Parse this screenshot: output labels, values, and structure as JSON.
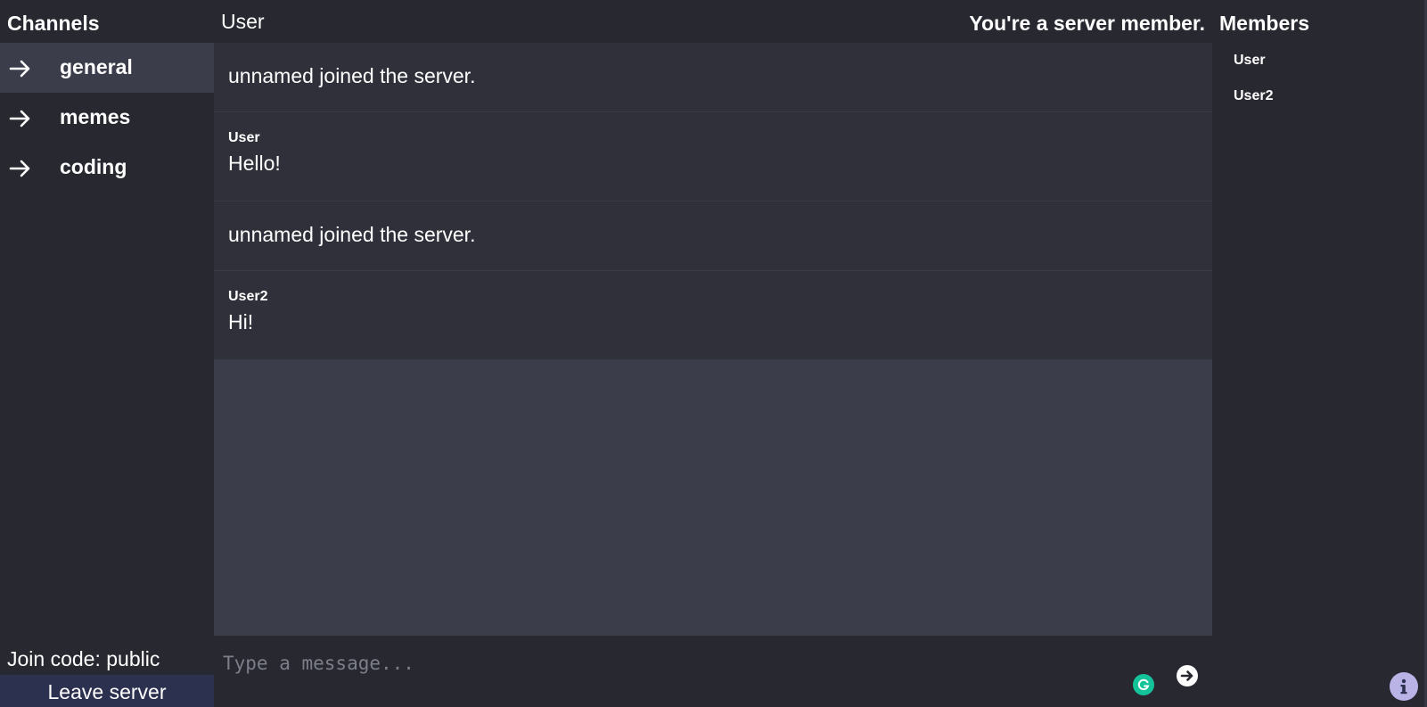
{
  "sidebar": {
    "title": "Channels",
    "channels": [
      {
        "label": "general",
        "active": true
      },
      {
        "label": "memes",
        "active": false
      },
      {
        "label": "coding",
        "active": false
      }
    ],
    "join_code": "Join code: public",
    "leave_label": "Leave server"
  },
  "header": {
    "user": "User",
    "status": "You're a server member."
  },
  "messages": [
    {
      "type": "system",
      "text": "unnamed joined the server."
    },
    {
      "type": "user",
      "author": "User",
      "text": "Hello!"
    },
    {
      "type": "system",
      "text": "unnamed joined the server."
    },
    {
      "type": "user",
      "author": "User2",
      "text": "Hi!"
    }
  ],
  "composer": {
    "placeholder": "Type a message..."
  },
  "members": {
    "title": "Members",
    "list": [
      "User",
      "User2"
    ]
  },
  "icons": {
    "channel": "arrow-right-icon",
    "send": "arrow-circle-right-icon",
    "grammarly": "grammarly-icon",
    "info": "info-icon"
  },
  "colors": {
    "background": "#272830",
    "message_bg": "#2f3039",
    "active_channel": "#3b3d4a",
    "leave_button": "#2d3150",
    "grammarly": "#15c39a",
    "info_button": "#b9b3e6"
  }
}
